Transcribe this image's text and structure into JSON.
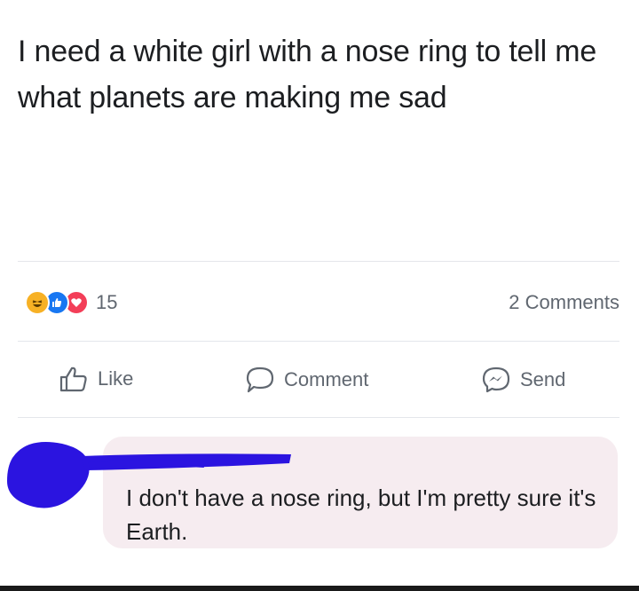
{
  "post": {
    "text": "I need a white girl with a nose ring to tell me what planets are making me sad"
  },
  "reactions": {
    "icons": [
      "haha-icon",
      "like-icon",
      "love-icon"
    ],
    "count": "15",
    "comments_label": "2 Comments"
  },
  "actions": {
    "like_label": "Like",
    "comment_label": "Comment",
    "send_label": "Send"
  },
  "comment": {
    "text": "I don't have a nose ring, but I'm pretty sure it's Earth."
  },
  "colors": {
    "haha": "#f7b125",
    "like": "#1877f2",
    "love": "#f33e58",
    "scribble": "#2b14e0",
    "bubble": "#f6ecf0"
  }
}
